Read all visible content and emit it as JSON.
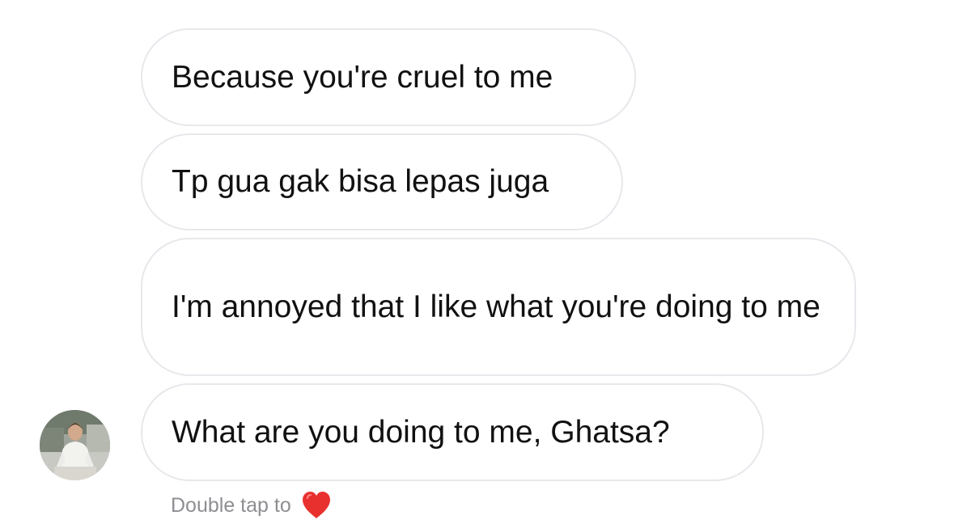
{
  "messages": [
    {
      "text": "Because you're cruel to me"
    },
    {
      "text": "Tp gua gak bisa lepas juga"
    },
    {
      "text": "I'm annoyed that I like what you're doing to me"
    },
    {
      "text": "What are you doing to me, Ghatsa?"
    }
  ],
  "hint": {
    "label": "Double tap to",
    "icon": "heart-icon"
  },
  "colors": {
    "bubble_border": "#e7e8ec",
    "hint_text": "#8e8e93",
    "heart": "#e8312f"
  }
}
